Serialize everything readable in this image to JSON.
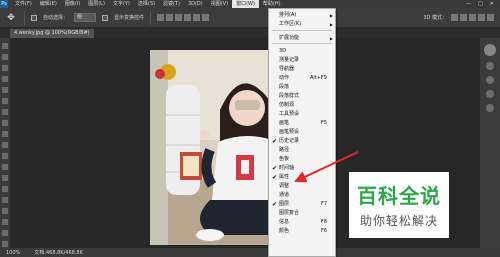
{
  "menubar": {
    "logo": "Ps",
    "items": [
      "文件(F)",
      "编辑(E)",
      "图像(I)",
      "图层(L)",
      "文字(Y)",
      "选择(S)",
      "滤镜(T)",
      "3D(D)",
      "视图(V)",
      "窗口(W)",
      "帮助(H)"
    ],
    "window_controls": [
      "—",
      "□",
      "✕"
    ]
  },
  "options": {
    "auto_select_label": "自动选择：",
    "auto_select_value": "组",
    "show_transform_label": "显示变换控件",
    "mode_label": "3D 模式："
  },
  "document_tab": {
    "label": "4.wenky.jpg @ 100%(RGB/8#)"
  },
  "status": {
    "zoom": "100%",
    "doc_info": "文档:468.8K/468.8K"
  },
  "window_menu": {
    "items": [
      {
        "label": "排列(A)",
        "submenu": true
      },
      {
        "label": "工作区(K)",
        "submenu": true
      },
      {
        "label": "扩展功能",
        "submenu": true
      },
      {
        "label": "3D"
      },
      {
        "label": "测量记录"
      },
      {
        "label": "导航器"
      },
      {
        "label": "动作",
        "shortcut": "Alt+F9"
      },
      {
        "label": "段落"
      },
      {
        "label": "段落样式"
      },
      {
        "label": "仿制源"
      },
      {
        "label": "工具预设"
      },
      {
        "label": "画笔",
        "shortcut": "F5"
      },
      {
        "label": "画笔预设"
      },
      {
        "label": "历史记录",
        "checked": true
      },
      {
        "label": "路径"
      },
      {
        "label": "色板"
      },
      {
        "label": "时间轴",
        "checked": true
      },
      {
        "label": "属性",
        "checked": true
      },
      {
        "label": "调整"
      },
      {
        "label": "通道"
      },
      {
        "label": "图层",
        "shortcut": "F7",
        "checked": true
      },
      {
        "label": "图层复合"
      },
      {
        "label": "信息",
        "shortcut": "F8"
      },
      {
        "label": "颜色",
        "shortcut": "F6"
      }
    ]
  },
  "watermark": {
    "title": "百科全说",
    "subtitle": "助你轻松解决"
  },
  "colors": {
    "accent_arrow": "#e8262a",
    "watermark_green": "#2aa84a"
  }
}
